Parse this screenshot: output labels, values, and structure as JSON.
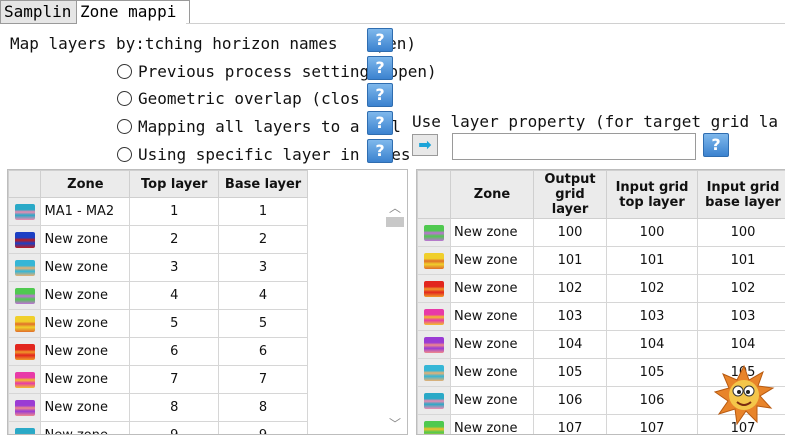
{
  "tabs": [
    "Samplin",
    "Zone mappi"
  ],
  "mapping": {
    "label": "Map layers by:",
    "partial": "tching horizon names",
    "partial_suffix": "pen)",
    "options": [
      {
        "label": "Previous process setting",
        "suffix": "(open)"
      },
      {
        "label": "Geometric overlap",
        "suffix": "(clos"
      },
      {
        "label": "Mapping all layers to a",
        "suffix": "l"
      },
      {
        "label": "Using specific layer in",
        "suffix": "es"
      }
    ],
    "use_layer_property": "Use layer property (for target grid la",
    "property_value": ""
  },
  "help_glyph": "?",
  "arrow_glyph": "➡",
  "left_table": {
    "headers": [
      "Zone",
      "Top layer",
      "Base layer"
    ],
    "rows": [
      {
        "zone": "MA1 - MA2",
        "top": "1",
        "base": "1",
        "color": "#2aa9c7",
        "color2": "#f08ab0"
      },
      {
        "zone": "New zone",
        "top": "2",
        "base": "2",
        "color": "#1c3fc4",
        "color2": "#c01a1a"
      },
      {
        "zone": "New zone",
        "top": "3",
        "base": "3",
        "color": "#35b6d6",
        "color2": "#e9b072"
      },
      {
        "zone": "New zone",
        "top": "4",
        "base": "4",
        "color": "#4fc94f",
        "color2": "#c070d8"
      },
      {
        "zone": "New zone",
        "top": "5",
        "base": "5",
        "color": "#f0cf2b",
        "color2": "#e06f2a"
      },
      {
        "zone": "New zone",
        "top": "6",
        "base": "6",
        "color": "#e2261e",
        "color2": "#f09a2a"
      },
      {
        "zone": "New zone",
        "top": "7",
        "base": "7",
        "color": "#e83aa8",
        "color2": "#f2c02a"
      },
      {
        "zone": "New zone",
        "top": "8",
        "base": "8",
        "color": "#9b3bd4",
        "color2": "#f08a8a"
      },
      {
        "zone": "New zone",
        "top": "9",
        "base": "9",
        "color": "#2aa9c7",
        "color2": "#f0c080"
      }
    ]
  },
  "right_table": {
    "headers": [
      "Zone",
      "Output grid layer",
      "Input grid top layer",
      "Input grid base layer"
    ],
    "rows": [
      {
        "zone": "New zone",
        "out": "100",
        "top": "100",
        "base": "100",
        "color": "#4fc94f",
        "color2": "#c070d8"
      },
      {
        "zone": "New zone",
        "out": "101",
        "top": "101",
        "base": "101",
        "color": "#f0cf2b",
        "color2": "#e06f2a"
      },
      {
        "zone": "New zone",
        "out": "102",
        "top": "102",
        "base": "102",
        "color": "#e2261e",
        "color2": "#f09a2a"
      },
      {
        "zone": "New zone",
        "out": "103",
        "top": "103",
        "base": "103",
        "color": "#e83aa8",
        "color2": "#f2c02a"
      },
      {
        "zone": "New zone",
        "out": "104",
        "top": "104",
        "base": "104",
        "color": "#9b3bd4",
        "color2": "#f08a8a"
      },
      {
        "zone": "New zone",
        "out": "105",
        "top": "105",
        "base": "105",
        "color": "#35b6d6",
        "color2": "#e9b072"
      },
      {
        "zone": "New zone",
        "out": "106",
        "top": "106",
        "base": "106",
        "color": "#2aa9c7",
        "color2": "#f08ab0"
      },
      {
        "zone": "New zone",
        "out": "107",
        "top": "107",
        "base": "107",
        "color": "#4fc94f",
        "color2": "#f2c02a"
      }
    ]
  }
}
